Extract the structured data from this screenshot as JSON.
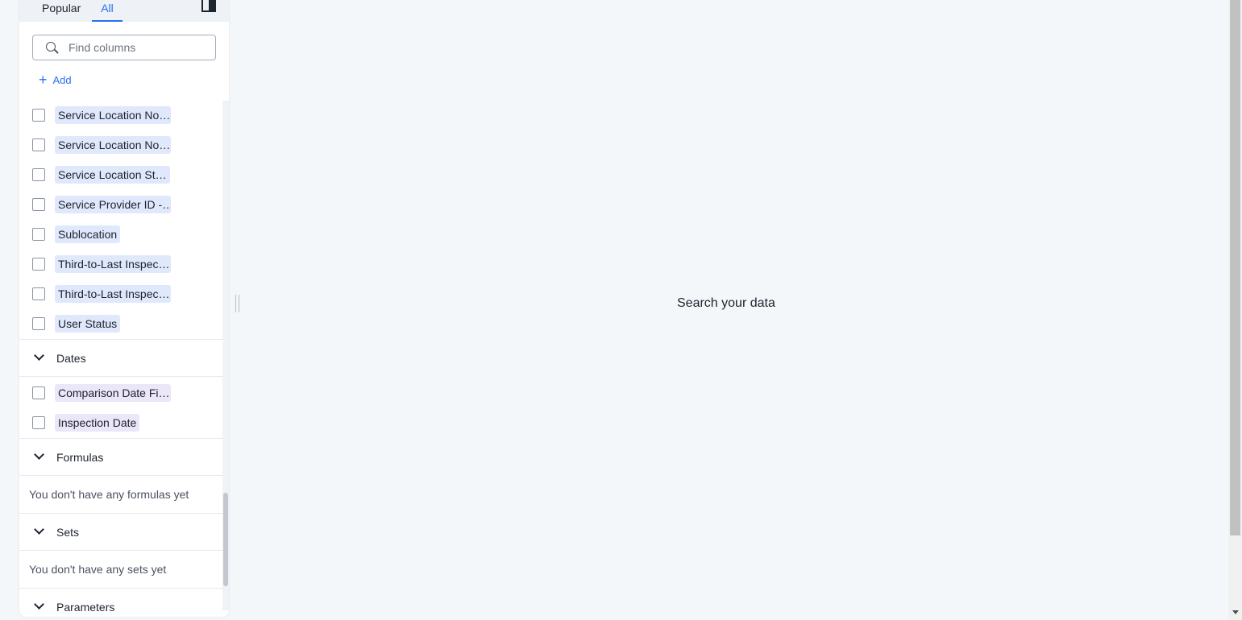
{
  "tabs": {
    "popular": "Popular",
    "all": "All"
  },
  "search": {
    "placeholder": "Find columns",
    "value": ""
  },
  "add_label": "Add",
  "attributes": [
    "Service Location No…",
    "Service Location No…",
    "Service Location St…",
    "Service Provider ID -…",
    "Sublocation",
    "Third-to-Last Inspec…",
    "Third-to-Last Inspec…",
    "User Status"
  ],
  "sections": {
    "dates": {
      "label": "Dates",
      "items": [
        "Comparison Date Fi…",
        "Inspection Date"
      ]
    },
    "formulas": {
      "label": "Formulas",
      "empty": "You don't have any formulas yet"
    },
    "sets": {
      "label": "Sets",
      "empty": "You don't have any sets yet"
    },
    "parameters": {
      "label": "Parameters"
    }
  },
  "main": {
    "message": "Search your data"
  },
  "colors": {
    "accent": "#2770ef",
    "chip_attribute": "#e0e8fb",
    "chip_date": "#ebe6f8",
    "background": "#f4f7fa"
  }
}
